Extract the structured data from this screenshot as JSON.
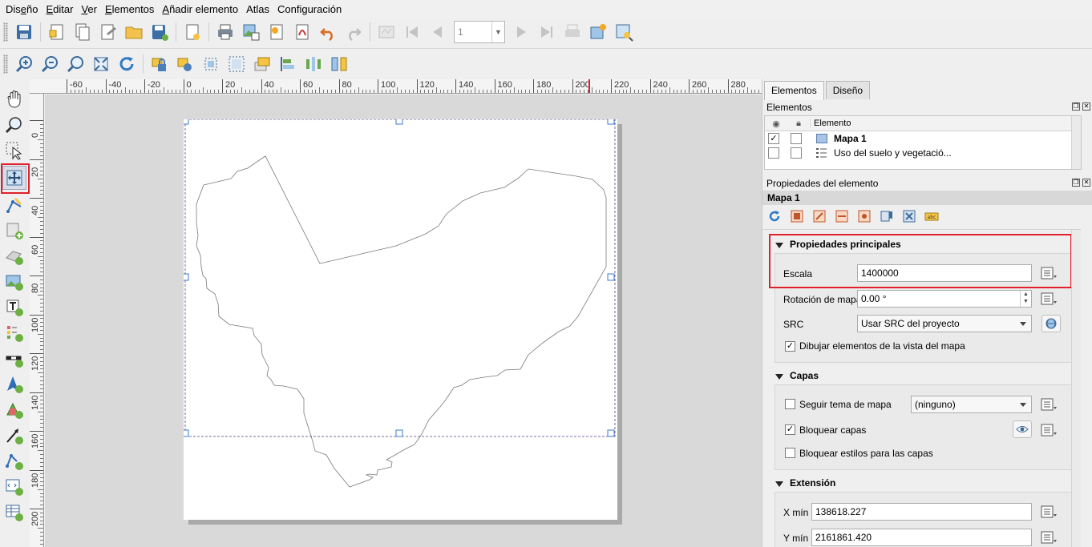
{
  "menu": [
    {
      "pre": "Dis",
      "ul": "e",
      "post": "ño"
    },
    {
      "pre": "",
      "ul": "E",
      "post": "ditar"
    },
    {
      "pre": "",
      "ul": "V",
      "post": "er"
    },
    {
      "pre": "",
      "ul": "E",
      "post": "lementos"
    },
    {
      "pre": "",
      "ul": "A",
      "post": "ñadir elemento"
    },
    {
      "pre": "",
      "ul": "",
      "post": "Atlas"
    },
    {
      "pre": "",
      "ul": "",
      "post": "Configuración"
    }
  ],
  "toolbar": {
    "page_value": "1"
  },
  "ruler_top": [
    "-60",
    "-40",
    "-20",
    "0",
    "20",
    "40",
    "60",
    "80",
    "100",
    "120",
    "140",
    "160",
    "180",
    "200",
    "220",
    "240",
    "260",
    "280"
  ],
  "ruler_left": [
    "0",
    "20",
    "40",
    "60",
    "80",
    "100",
    "120",
    "140",
    "160",
    "180",
    "200"
  ],
  "panel": {
    "tabs": [
      "Elementos",
      "Diseño"
    ],
    "elements_title": "Elementos",
    "col_element": "Elemento",
    "items": [
      {
        "label": "Mapa 1",
        "visible": true,
        "locked": false
      },
      {
        "label": "Uso del suelo y vegetació...",
        "visible": false,
        "locked": false
      }
    ],
    "props_title": "Propiedades del elemento",
    "item_name": "Mapa 1"
  },
  "main_props": {
    "title": "Propiedades principales",
    "scale_label": "Escala",
    "scale_value": "1400000",
    "rotation_label": "Rotación de mapa",
    "rotation_value": "0.00 °",
    "crs_label": "SRC",
    "crs_value": "Usar SRC del proyecto",
    "draw_items_label": "Dibujar elementos de la vista del mapa",
    "draw_items_checked": "✓"
  },
  "layers": {
    "title": "Capas",
    "follow_theme_label": "Seguir tema de mapa",
    "theme_value": "(ninguno)",
    "lock_layers_label": "Bloquear capas",
    "lock_layers_checked": "✓",
    "lock_styles_label": "Bloquear estilos para las capas"
  },
  "extent": {
    "title": "Extensión",
    "xmin_label": "X mín",
    "xmin_value": "138618.227",
    "ymin_label": "Y mín",
    "ymin_value": "2161861.420"
  },
  "colors": {
    "highlight": "#e0202a",
    "selection_handle": "#3a7bd5"
  }
}
